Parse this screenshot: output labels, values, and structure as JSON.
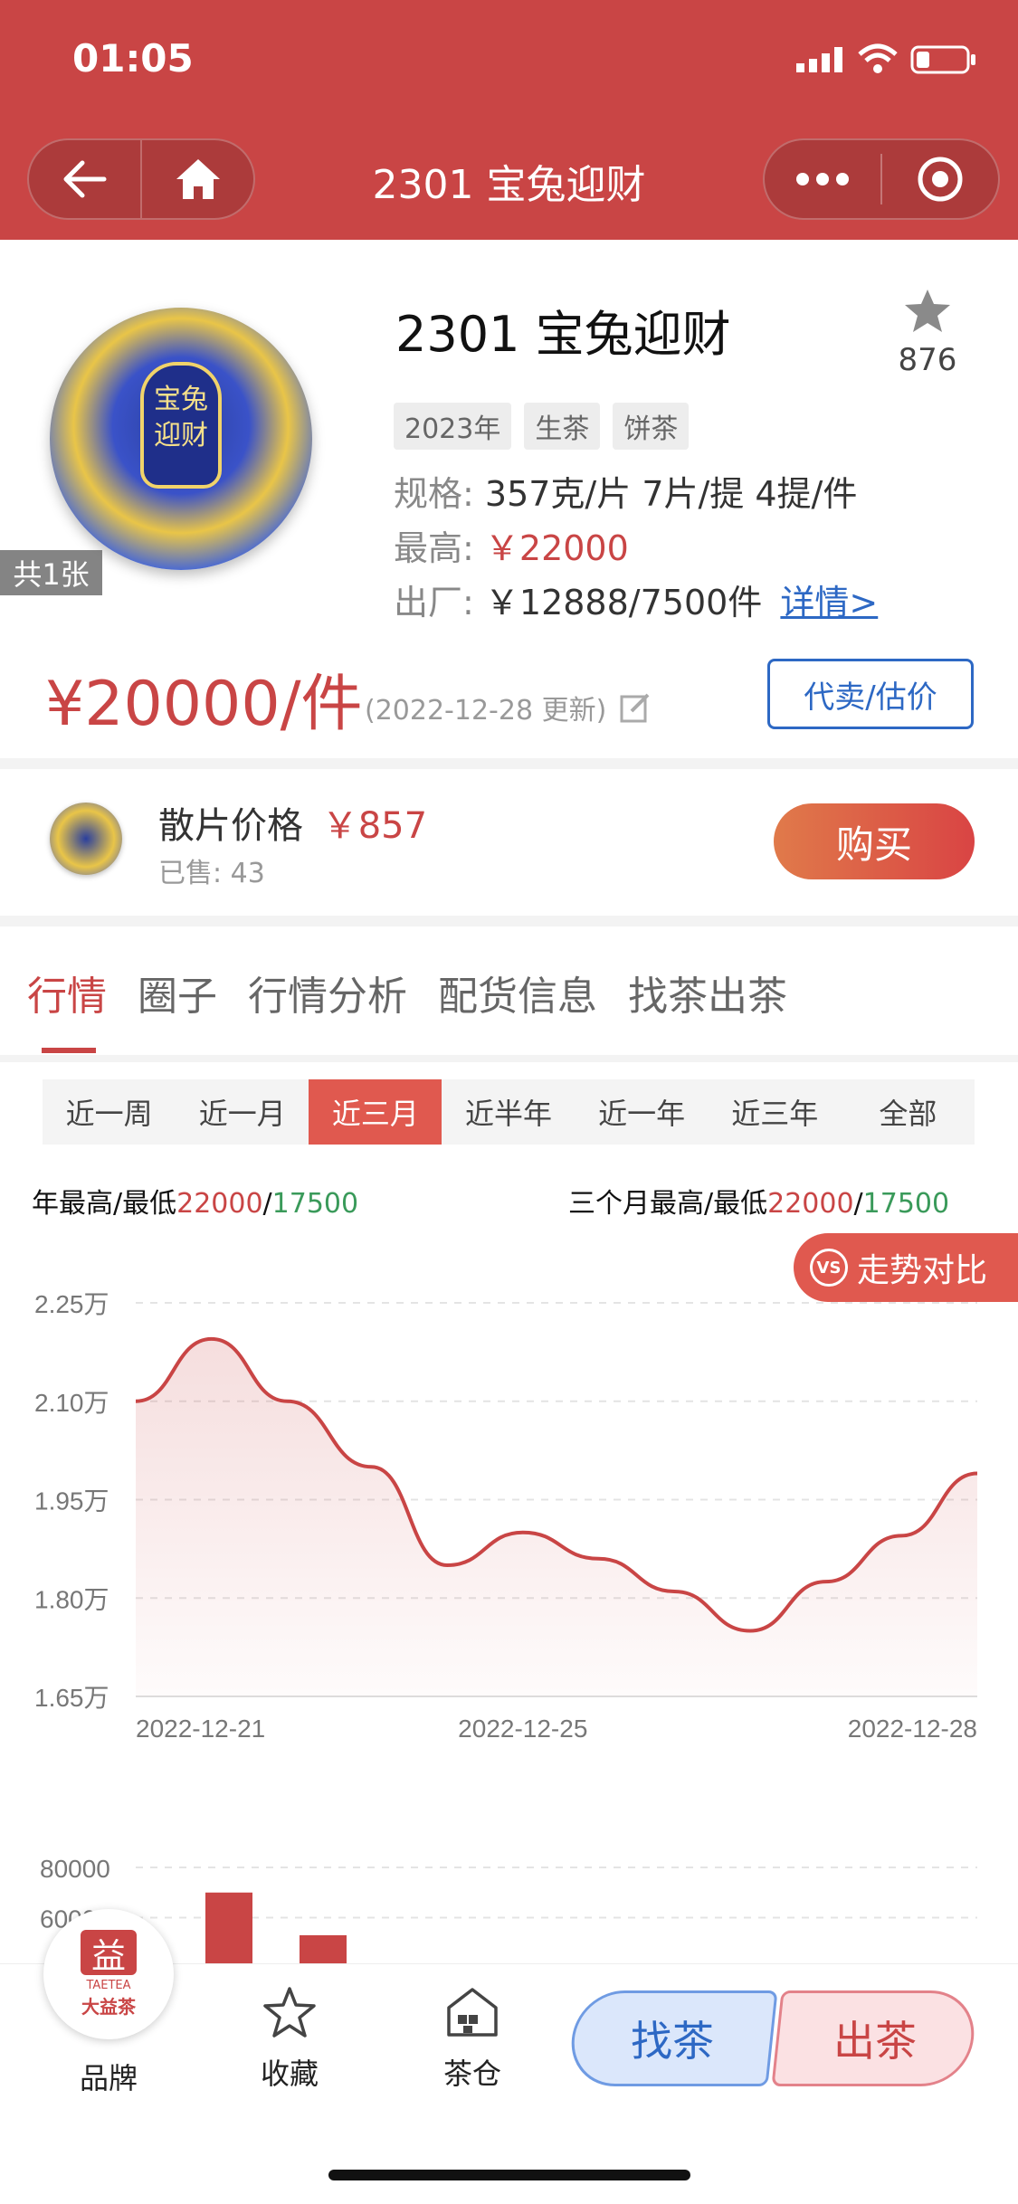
{
  "status_bar": {
    "time": "01:05"
  },
  "nav": {
    "title": "2301 宝兔迎财"
  },
  "product": {
    "image_count": "共1张",
    "title": "2301 宝兔迎财",
    "favorites": "876",
    "tags": [
      "2023年",
      "生茶",
      "饼茶"
    ],
    "spec_label": "规格:",
    "spec_value": "357克/片 7片/提 4提/件",
    "high_label": "最高:",
    "high_value": "￥22000",
    "factory_label": "出厂:",
    "factory_value": "￥12888/7500件",
    "detail_link": "详情>",
    "price": "¥20000/件",
    "price_updated": "(2022-12-28 更新)",
    "consign_button": "代卖/估价"
  },
  "loose": {
    "label": "散片价格",
    "price": "￥857",
    "sold": "已售: 43",
    "buy_button": "购买"
  },
  "tabs": [
    "行情",
    "圈子",
    "行情分析",
    "配货信息",
    "找茶出茶"
  ],
  "periods": [
    "近一周",
    "近一月",
    "近三月",
    "近半年",
    "近一年",
    "近三年",
    "全部"
  ],
  "stats": {
    "year_label": "年最高/最低",
    "year_high": "22000",
    "year_low": "17500",
    "three_month_label": "三个月最高/最低",
    "three_month_high": "22000",
    "three_month_low": "17500",
    "slash": "/"
  },
  "compare_button": {
    "icon_text": "VS",
    "label": "走势对比"
  },
  "chart_data": [
    {
      "type": "area",
      "x_ticks": [
        "2022-12-21",
        "2022-12-25",
        "2022-12-28"
      ],
      "y_ticks": [
        "2.25万",
        "2.10万",
        "1.95万",
        "1.80万",
        "1.65万"
      ],
      "ylim": [
        16500,
        22500
      ],
      "grid": true,
      "color": "#c94545",
      "series": [
        {
          "points": [
            [
              0.0,
              21000
            ],
            [
              0.09,
              21950
            ],
            [
              0.18,
              21000
            ],
            [
              0.28,
              20000
            ],
            [
              0.37,
              18500
            ],
            [
              0.46,
              19000
            ],
            [
              0.55,
              18600
            ],
            [
              0.64,
              18100
            ],
            [
              0.73,
              17500
            ],
            [
              0.82,
              18250
            ],
            [
              0.91,
              18950
            ],
            [
              1.0,
              19900
            ]
          ]
        }
      ]
    },
    {
      "type": "bar",
      "y_ticks": [
        "80000",
        "60000"
      ],
      "color": "#c94545",
      "values": [
        0,
        70000,
        0,
        53000
      ]
    }
  ],
  "tabbar": {
    "brand_logo_cn": "大益茶",
    "brand_logo_en": "TAETEA",
    "brand_logo_mark": "益",
    "brand": "品牌",
    "favorites": "收藏",
    "warehouse": "茶仓",
    "find_tea": "找茶",
    "sell_tea": "出茶"
  }
}
